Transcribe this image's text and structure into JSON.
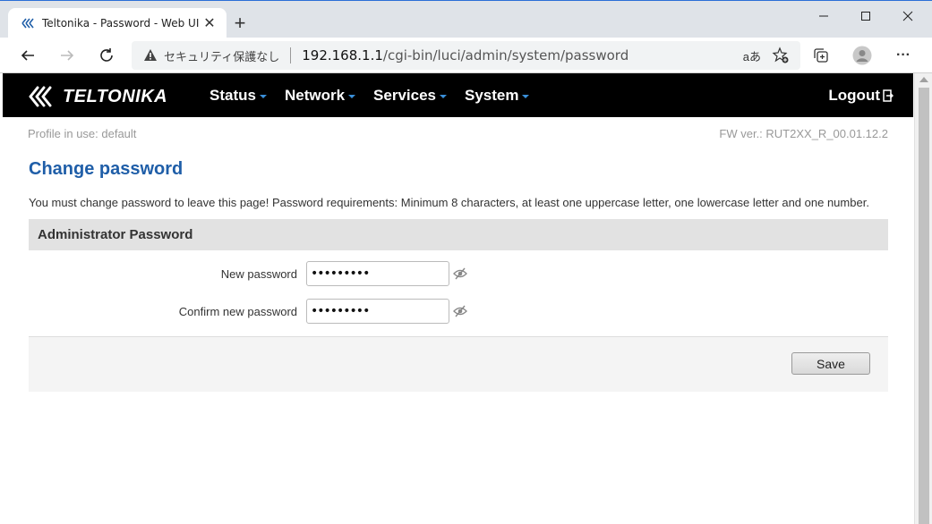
{
  "browser": {
    "tab_title": "Teltonika - Password - Web UI",
    "new_tab_label": "+",
    "security_label": "セキュリティ保護なし",
    "url_host": "192.168.1.1",
    "url_path": "/cgi-bin/luci/admin/system/password",
    "read_aloud_label": "aあ",
    "more_label": "···"
  },
  "topnav": {
    "logo_text": "TELTONIKA",
    "menu": [
      {
        "label": "Status"
      },
      {
        "label": "Network"
      },
      {
        "label": "Services"
      },
      {
        "label": "System"
      }
    ],
    "logout_label": "Logout"
  },
  "meta": {
    "profile": "Profile in use: default",
    "fw_version": "FW ver.: RUT2XX_R_00.01.12.2"
  },
  "page": {
    "title": "Change password",
    "description": "You must change password to leave this page! Password requirements: Minimum 8 characters, at least one uppercase letter, one lowercase letter and one number."
  },
  "section": {
    "title": "Administrator Password",
    "fields": [
      {
        "label": "New password",
        "value": "•••••••••"
      },
      {
        "label": "Confirm new password",
        "value": "•••••••••"
      }
    ]
  },
  "actions": {
    "save_label": "Save"
  },
  "colors": {
    "accent": "#1f5ea8",
    "caret": "#3a8fd9",
    "nav_bg": "#000000"
  }
}
